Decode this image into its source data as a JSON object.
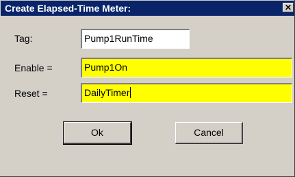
{
  "dialog": {
    "title": "Create Elapsed-Time Meter:",
    "close_glyph": "✕"
  },
  "form": {
    "tag": {
      "label": "Tag:",
      "value": "Pump1RunTime"
    },
    "enable": {
      "label": "Enable =",
      "value": "Pump1On"
    },
    "reset": {
      "label": "Reset =",
      "value": "DailyTimer"
    }
  },
  "buttons": {
    "ok": "Ok",
    "cancel": "Cancel"
  },
  "colors": {
    "titlebar": "#0a246a",
    "face": "#d4d0c8",
    "highlight_field": "#ffff00"
  }
}
